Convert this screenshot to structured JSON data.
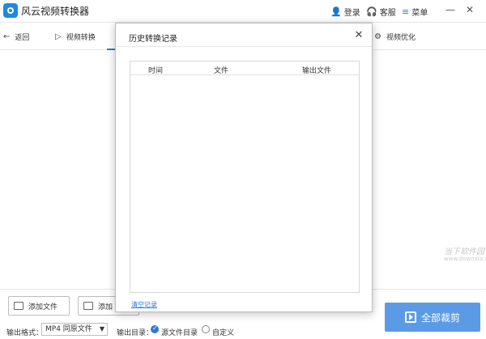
{
  "app": {
    "title": "风云视频转换器"
  },
  "titlebar": {
    "login": "登录",
    "service": "客服",
    "menu": "菜单"
  },
  "nav": {
    "back": "返回",
    "convert": "视频转换",
    "optimize": "视频优化"
  },
  "bottom": {
    "add_file": "添加文件",
    "add_folder": "添加",
    "output_format_label": "输出格式：",
    "output_format_value": "MP4 同原文件",
    "output_dir_label": "输出目录：",
    "dir_source": "源文件目录",
    "dir_custom": "自定义",
    "convert_all": "全部裁剪"
  },
  "dialog": {
    "title": "历史转换记录",
    "columns": [
      "时间",
      "文件",
      "输出文件"
    ],
    "rows": [],
    "clear_link": "清空记录"
  },
  "watermark": {
    "brand": "当下软件园",
    "url": "www.downxia.com"
  },
  "icons": {
    "logo": "app-logo-icon",
    "login": "user-icon",
    "service": "headset-icon",
    "menu": "hamburger-icon",
    "back": "arrow-left-icon",
    "convert": "play-icon",
    "optimize": "gear-icon",
    "close": "close-icon"
  },
  "colors": {
    "accent": "#2d7bd8",
    "primary_button": "#5b9be6"
  }
}
